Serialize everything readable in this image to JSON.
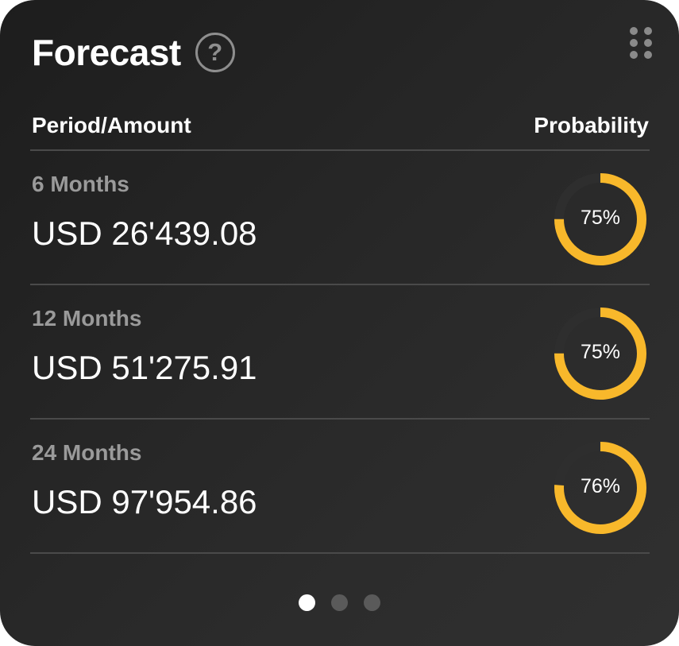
{
  "widget": {
    "title": "Forecast",
    "help_icon": "question-circle-icon",
    "help_glyph": "?",
    "menu_icon": "grip-dots-icon"
  },
  "table": {
    "col_period": "Period/Amount",
    "col_probability": "Probability",
    "rows": [
      {
        "period": "6 Months",
        "amount": "USD 26'439.08",
        "probability": 0.75,
        "probability_label": "75%"
      },
      {
        "period": "12 Months",
        "amount": "USD 51'275.91",
        "probability": 0.75,
        "probability_label": "75%"
      },
      {
        "period": "24 Months",
        "amount": "USD 97'954.86",
        "probability": 0.76,
        "probability_label": "76%"
      }
    ]
  },
  "pager": {
    "pages": 3,
    "active_index": 0
  },
  "colors": {
    "accent": "#f8b82b",
    "ring_track": "#2e2e2e",
    "background": "#262626"
  }
}
